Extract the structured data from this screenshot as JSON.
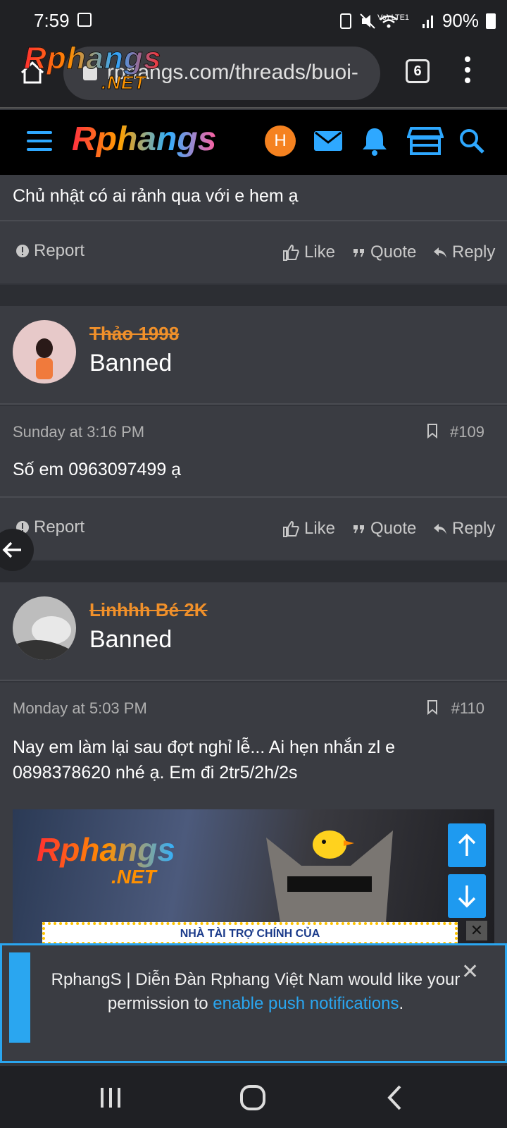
{
  "status_bar": {
    "time": "7:59",
    "battery": "90%",
    "network": "Vo) LTE1"
  },
  "browser": {
    "url": "rphangs.com/threads/buoi-",
    "tab_count": "6",
    "overlay_logo_main": "Rphangs",
    "overlay_logo_sub": ".NET"
  },
  "site": {
    "logo": "Rphangs",
    "avatar_initial": "H"
  },
  "actions": {
    "report": "Report",
    "like": "Like",
    "quote": "Quote",
    "reply": "Reply"
  },
  "posts": [
    {
      "text": "Chủ nhật có ai rảnh qua với e hem ạ"
    },
    {
      "user": "Thảo 1998",
      "title": "Banned",
      "date": "Sunday at 3:16 PM",
      "number": "#109",
      "text": "Số em 0963097499 ạ"
    },
    {
      "user": "Linhhh Bé 2K",
      "title": "Banned",
      "date": "Monday at 5:03 PM",
      "number": "#110",
      "text_line1": "Nay em làm lại sau đợt nghỉ lễ... Ai hẹn nhắn zl e",
      "text_line2": "0898378620 nhé ạ. Em đi 2tr5/2h/2s"
    }
  ],
  "banner": {
    "logo_main": "Rphangs",
    "logo_sub": ".NET",
    "sponsor_text": "NHÀ TÀI TRỢ CHÍNH CỦA"
  },
  "push": {
    "text_before": "RphangS | Diễn Đàn Rphang Việt Nam would like your permission to ",
    "link": "enable push notifications",
    "text_after": "."
  },
  "colors": {
    "accent": "#2aa6f0",
    "username": "#f0902a",
    "avatar_h": "#f58220",
    "background": "#32343a"
  }
}
